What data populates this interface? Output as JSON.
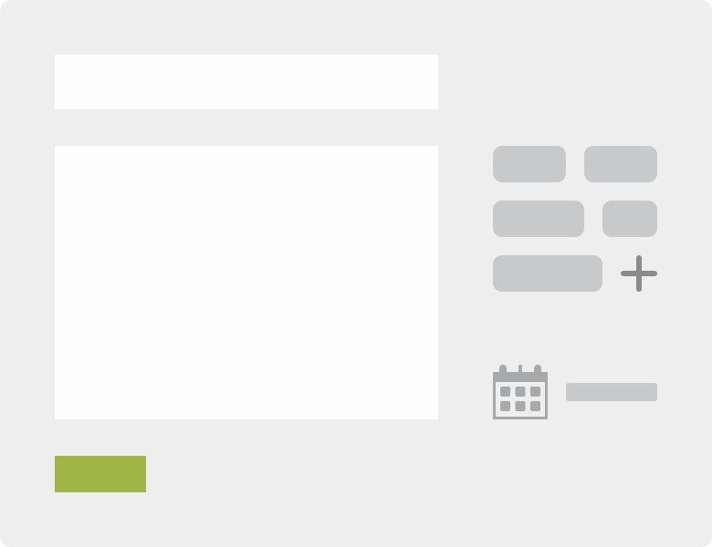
{
  "form": {
    "title_value": "",
    "body_value": "",
    "submit_label": ""
  },
  "tags": {
    "chips": [
      {
        "label": ""
      },
      {
        "label": ""
      },
      {
        "label": ""
      },
      {
        "label": ""
      },
      {
        "label": ""
      }
    ]
  },
  "icons": {
    "add": "plus-icon",
    "date": "calendar-icon"
  },
  "date": {
    "value": ""
  },
  "colors": {
    "background": "#eeeeee",
    "field": "#fdfdfe",
    "chip": "#c8c9ca",
    "icon": "#8a8b8c",
    "accent": "#a0b545"
  }
}
